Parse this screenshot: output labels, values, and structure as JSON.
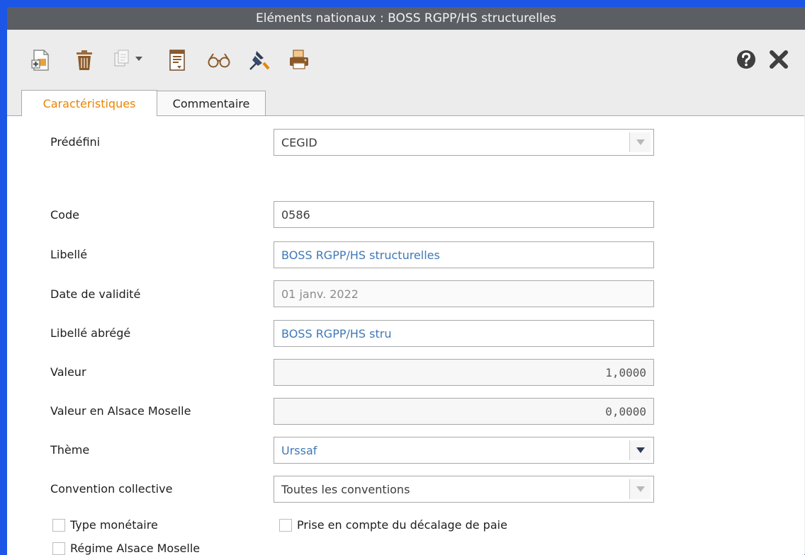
{
  "window": {
    "title": "Eléments nationaux :  BOSS RGPP/HS structurelles"
  },
  "toolbar": {
    "icons": [
      "new-document-icon",
      "delete-trash-icon",
      "copy-icon",
      "dropdown-arrow-icon",
      "report-icon",
      "glasses-icon",
      "pin-icon",
      "print-icon",
      "help-icon",
      "close-icon"
    ]
  },
  "tabs": [
    {
      "label": "Caractéristiques",
      "active": true
    },
    {
      "label": "Commentaire",
      "active": false
    }
  ],
  "form": {
    "predefini": {
      "label": "Prédéfini",
      "value": "CEGID"
    },
    "code": {
      "label": "Code",
      "value": "0586"
    },
    "libelle": {
      "label": "Libellé",
      "value": "BOSS RGPP/HS structurelles"
    },
    "date_validite": {
      "label": "Date de validité",
      "value": "01 janv. 2022"
    },
    "libelle_abrege": {
      "label": "Libellé abrégé",
      "value": "BOSS RGPP/HS stru"
    },
    "valeur": {
      "label": "Valeur",
      "value": "1,0000"
    },
    "valeur_alsace": {
      "label": "Valeur en Alsace Moselle",
      "value": "0,0000"
    },
    "theme": {
      "label": "Thème",
      "value": "Urssaf"
    },
    "convention": {
      "label": "Convention collective",
      "value": "Toutes les conventions"
    },
    "type_monetaire": {
      "label": "Type monétaire",
      "checked": false
    },
    "decalage_paie": {
      "label": "Prise en compte du décalage de paie",
      "checked": false
    },
    "regime_alsace": {
      "label": "Régime Alsace Moselle",
      "checked": false
    }
  },
  "colors": {
    "accent_tab": "#e88500",
    "title_bar": "#5b5f64",
    "frame": "#1c56e6",
    "field_blue_text": "#3f78b7"
  }
}
